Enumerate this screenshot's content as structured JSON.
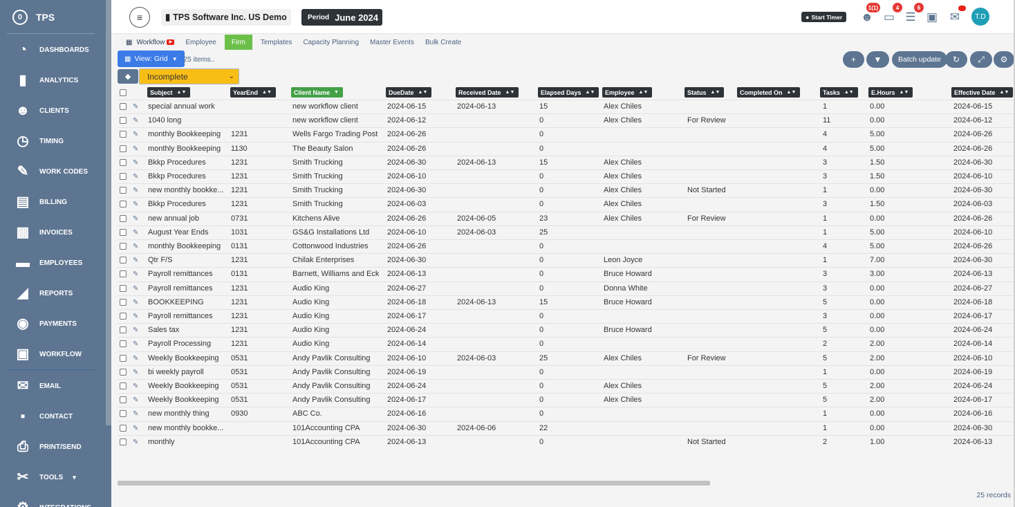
{
  "brand": {
    "logo_text": "0",
    "name": "TPS"
  },
  "sidebar": {
    "items": [
      {
        "label": "DASHBOARDS",
        "icon": "◔",
        "name": "dashboards"
      },
      {
        "label": "ANALYTICS",
        "icon": "▮",
        "name": "analytics"
      },
      {
        "label": "CLIENTS",
        "icon": "☻",
        "name": "clients"
      },
      {
        "label": "TIMING",
        "icon": "◷",
        "name": "timing"
      },
      {
        "label": "WORK CODES",
        "icon": "✎",
        "name": "work-codes"
      },
      {
        "label": "BILLING",
        "icon": "▤",
        "name": "billing"
      },
      {
        "label": "INVOICES",
        "icon": "▦",
        "name": "invoices"
      },
      {
        "label": "EMPLOYEES",
        "icon": "▬",
        "name": "employees"
      },
      {
        "label": "REPORTS",
        "icon": "◢",
        "name": "reports"
      },
      {
        "label": "PAYMENTS",
        "icon": "◉",
        "name": "payments"
      },
      {
        "label": "WORKFLOW",
        "icon": "▣",
        "name": "workflow"
      },
      {
        "label": "EMAIL",
        "icon": "✉",
        "name": "email"
      },
      {
        "label": "CONTACT",
        "icon": "▪",
        "name": "contact"
      },
      {
        "label": "PRINT/SEND",
        "icon": "⎙",
        "name": "print-send"
      },
      {
        "label": "TOOLS",
        "icon": "✂",
        "name": "tools"
      },
      {
        "label": "INTEGRATIONS",
        "icon": "⚙",
        "name": "integrations"
      }
    ],
    "tools_caret": "▾"
  },
  "topbar": {
    "menu_icon": "≡",
    "company_name": "TPS Software Inc. US Demo",
    "period_label": "Period",
    "period_value": "June 2024",
    "timer_label": "Start Timer",
    "badges": {
      "team": "1(1)",
      "inbox": "4",
      "tasks": "6"
    },
    "avatar": "T.D"
  },
  "tabs": {
    "workflow": "Workflow",
    "employee": "Employee",
    "firm": "Firm",
    "templates": "Templates",
    "capacity": "Capacity Planning",
    "master_events": "Master Events",
    "bulk_create": "Bulk Create"
  },
  "toolbar": {
    "view_label": "View: Grid",
    "items_count": "25 items..",
    "batch_update": "Batch update",
    "status_filter": "Incomplete"
  },
  "columns": {
    "subject": "Subject",
    "yearend": "YearEnd",
    "client": "Client Name",
    "due": "DueDate",
    "received": "Received Date",
    "elapsed": "Elapsed Days",
    "employee": "Employee",
    "status": "Status",
    "completed": "Completed On",
    "tasks": "Tasks",
    "ehours": "E.Hours",
    "effective": "Effective Date"
  },
  "rows": [
    {
      "subject": "special annual work",
      "yearend": "",
      "client": "new workflow client",
      "due": "2024-06-15",
      "received": "2024-06-13",
      "elapsed": "15",
      "employee": "Alex Chiles",
      "status": "",
      "completed": "",
      "tasks": "1",
      "ehours": "0.00",
      "effective": "2024-06-15"
    },
    {
      "subject": "1040 long",
      "yearend": "",
      "client": "new workflow client",
      "due": "2024-06-12",
      "received": "",
      "elapsed": "0",
      "employee": "Alex Chiles",
      "status": "For Review",
      "completed": "",
      "tasks": "11",
      "ehours": "0.00",
      "effective": "2024-06-12"
    },
    {
      "subject": "monthly Bookkeeping",
      "yearend": "1231",
      "client": "Wells Fargo Trading Post",
      "due": "2024-06-26",
      "received": "",
      "elapsed": "0",
      "employee": "",
      "status": "",
      "completed": "",
      "tasks": "4",
      "ehours": "5.00",
      "effective": "2024-06-26"
    },
    {
      "subject": "monthly Bookkeeping",
      "yearend": "1130",
      "client": "The Beauty Salon",
      "due": "2024-06-26",
      "received": "",
      "elapsed": "0",
      "employee": "",
      "status": "",
      "completed": "",
      "tasks": "4",
      "ehours": "5.00",
      "effective": "2024-06-26"
    },
    {
      "subject": "Bkkp Procedures",
      "yearend": "1231",
      "client": "Smith Trucking",
      "due": "2024-06-30",
      "received": "2024-06-13",
      "elapsed": "15",
      "employee": "Alex Chiles",
      "status": "",
      "completed": "",
      "tasks": "3",
      "ehours": "1.50",
      "effective": "2024-06-30"
    },
    {
      "subject": "Bkkp Procedures",
      "yearend": "1231",
      "client": "Smith Trucking",
      "due": "2024-06-10",
      "received": "",
      "elapsed": "0",
      "employee": "Alex Chiles",
      "status": "",
      "completed": "",
      "tasks": "3",
      "ehours": "1.50",
      "effective": "2024-06-10"
    },
    {
      "subject": "new monthly bookke...",
      "yearend": "1231",
      "client": "Smith Trucking",
      "due": "2024-06-30",
      "received": "",
      "elapsed": "0",
      "employee": "Alex Chiles",
      "status": "Not Started",
      "completed": "",
      "tasks": "1",
      "ehours": "0.00",
      "effective": "2024-06-30"
    },
    {
      "subject": "Bkkp Procedures",
      "yearend": "1231",
      "client": "Smith Trucking",
      "due": "2024-06-03",
      "received": "",
      "elapsed": "0",
      "employee": "Alex Chiles",
      "status": "",
      "completed": "",
      "tasks": "3",
      "ehours": "1.50",
      "effective": "2024-06-03"
    },
    {
      "subject": "new annual job",
      "yearend": "0731",
      "client": "Kitchens Alive",
      "due": "2024-06-26",
      "received": "2024-06-05",
      "elapsed": "23",
      "employee": "Alex Chiles",
      "status": "For Review",
      "completed": "",
      "tasks": "1",
      "ehours": "0.00",
      "effective": "2024-06-26"
    },
    {
      "subject": "August Year Ends",
      "yearend": "1031",
      "client": "GS&G Installations Ltd",
      "due": "2024-06-10",
      "received": "2024-06-03",
      "elapsed": "25",
      "employee": "",
      "status": "",
      "completed": "",
      "tasks": "1",
      "ehours": "5.00",
      "effective": "2024-06-10"
    },
    {
      "subject": "monthly Bookkeeping",
      "yearend": "0131",
      "client": "Cottonwood Industries",
      "due": "2024-06-26",
      "received": "",
      "elapsed": "0",
      "employee": "",
      "status": "",
      "completed": "",
      "tasks": "4",
      "ehours": "5.00",
      "effective": "2024-06-26"
    },
    {
      "subject": "Qtr F/S",
      "yearend": "1231",
      "client": "Chilak Enterprises",
      "due": "2024-06-30",
      "received": "",
      "elapsed": "0",
      "employee": "Leon Joyce",
      "status": "",
      "completed": "",
      "tasks": "1",
      "ehours": "7.00",
      "effective": "2024-06-30"
    },
    {
      "subject": "Payroll remittances",
      "yearend": "0131",
      "client": "Barnett, Williams and Eck",
      "due": "2024-06-13",
      "received": "",
      "elapsed": "0",
      "employee": "Bruce Howard",
      "status": "",
      "completed": "",
      "tasks": "3",
      "ehours": "3.00",
      "effective": "2024-06-13"
    },
    {
      "subject": "Payroll remittances",
      "yearend": "1231",
      "client": "Audio King",
      "due": "2024-06-27",
      "received": "",
      "elapsed": "0",
      "employee": "Donna White",
      "status": "",
      "completed": "",
      "tasks": "3",
      "ehours": "0.00",
      "effective": "2024-06-27"
    },
    {
      "subject": "BOOKKEEPING",
      "yearend": "1231",
      "client": "Audio King",
      "due": "2024-06-18",
      "received": "2024-06-13",
      "elapsed": "15",
      "employee": "Bruce Howard",
      "status": "",
      "completed": "",
      "tasks": "5",
      "ehours": "0.00",
      "effective": "2024-06-18"
    },
    {
      "subject": "Payroll remittances",
      "yearend": "1231",
      "client": "Audio King",
      "due": "2024-06-17",
      "received": "",
      "elapsed": "0",
      "employee": "",
      "status": "",
      "completed": "",
      "tasks": "3",
      "ehours": "0.00",
      "effective": "2024-06-17"
    },
    {
      "subject": "Sales tax",
      "yearend": "1231",
      "client": "Audio King",
      "due": "2024-06-24",
      "received": "",
      "elapsed": "0",
      "employee": "Bruce Howard",
      "status": "",
      "completed": "",
      "tasks": "5",
      "ehours": "0.00",
      "effective": "2024-06-24"
    },
    {
      "subject": "Payroll Processing",
      "yearend": "1231",
      "client": "Audio King",
      "due": "2024-06-14",
      "received": "",
      "elapsed": "0",
      "employee": "",
      "status": "",
      "completed": "",
      "tasks": "2",
      "ehours": "2.00",
      "effective": "2024-06-14"
    },
    {
      "subject": "Weekly Bookkeeping",
      "yearend": "0531",
      "client": "Andy Pavlik Consulting",
      "due": "2024-06-10",
      "received": "2024-06-03",
      "elapsed": "25",
      "employee": "Alex Chiles",
      "status": "For Review",
      "completed": "",
      "tasks": "5",
      "ehours": "2.00",
      "effective": "2024-06-10"
    },
    {
      "subject": "bi weekly payroll",
      "yearend": "0531",
      "client": "Andy Pavlik Consulting",
      "due": "2024-06-19",
      "received": "",
      "elapsed": "0",
      "employee": "",
      "status": "",
      "completed": "",
      "tasks": "1",
      "ehours": "0.00",
      "effective": "2024-06-19"
    },
    {
      "subject": "Weekly Bookkeeping",
      "yearend": "0531",
      "client": "Andy Pavlik Consulting",
      "due": "2024-06-24",
      "received": "",
      "elapsed": "0",
      "employee": "Alex Chiles",
      "status": "",
      "completed": "",
      "tasks": "5",
      "ehours": "2.00",
      "effective": "2024-06-24"
    },
    {
      "subject": "Weekly Bookkeeping",
      "yearend": "0531",
      "client": "Andy Pavlik Consulting",
      "due": "2024-06-17",
      "received": "",
      "elapsed": "0",
      "employee": "Alex Chiles",
      "status": "",
      "completed": "",
      "tasks": "5",
      "ehours": "2.00",
      "effective": "2024-06-17"
    },
    {
      "subject": "new monthly thing",
      "yearend": "0930",
      "client": "ABC Co.",
      "due": "2024-06-16",
      "received": "",
      "elapsed": "0",
      "employee": "",
      "status": "",
      "completed": "",
      "tasks": "1",
      "ehours": "0.00",
      "effective": "2024-06-16"
    },
    {
      "subject": "new monthly bookke...",
      "yearend": "",
      "client": "101Accounting CPA",
      "due": "2024-06-30",
      "received": "2024-06-06",
      "elapsed": "22",
      "employee": "",
      "status": "",
      "completed": "",
      "tasks": "1",
      "ehours": "0.00",
      "effective": "2024-06-30"
    },
    {
      "subject": "monthly",
      "yearend": "",
      "client": "101Accounting CPA",
      "due": "2024-06-13",
      "received": "",
      "elapsed": "0",
      "employee": "",
      "status": "Not Started",
      "completed": "",
      "tasks": "2",
      "ehours": "1.00",
      "effective": "2024-06-13"
    }
  ],
  "footer": {
    "records": "25 records"
  },
  "colors": {
    "sidebar": "#5d7591",
    "accent_green": "#6cc04a",
    "accent_blue": "#3b7be8",
    "filter_yellow": "#f9be16",
    "badge_red": "#e53935"
  }
}
